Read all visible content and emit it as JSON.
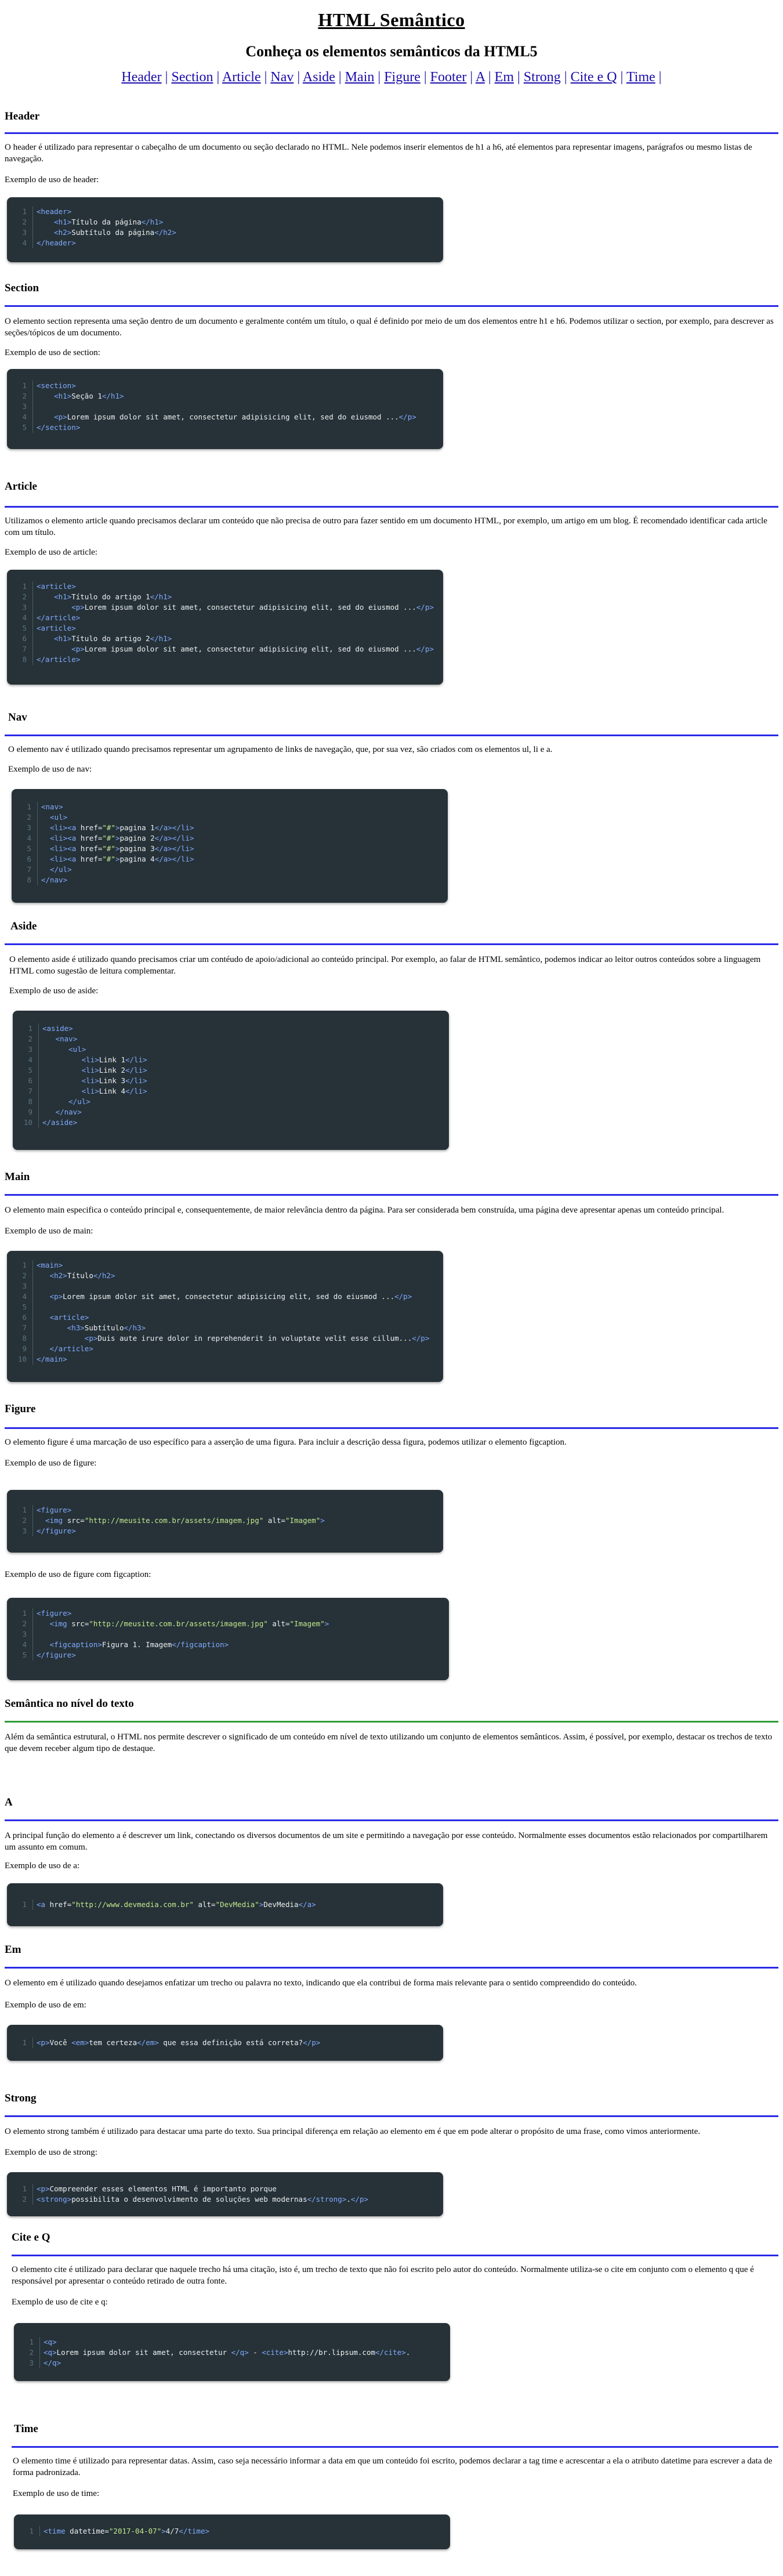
{
  "header": {
    "title": "HTML Semântico",
    "subtitle": "Conheça os elementos semânticos da HTML5",
    "nav": [
      "Header",
      "Section",
      "Article",
      "Nav",
      "Aside",
      "Main",
      "Figure",
      "Footer",
      "A",
      "Em",
      "Strong",
      "Cite e Q",
      "Time"
    ]
  },
  "sections": {
    "header": {
      "title": "Header",
      "text": "O header é utilizado para representar o cabeçalho de um documento ou seção declarado no HTML. Nele podemos inserir elementos de h1 a h6, até elementos para representar imagens, parágrafos ou mesmo listas de navegação.",
      "example_label": "Exemplo de uso de header:",
      "code": [
        "<header>",
        "    <h1>Título da página</h1>",
        "    <h2>Subtítulo da página</h2>",
        "</header>"
      ]
    },
    "section": {
      "title": "Section",
      "text": "O elemento section representa uma seção dentro de um documento e geralmente contém um título, o qual é definido por meio de um dos elementos entre h1 e h6. Podemos utilizar o section, por exemplo, para descrever as seções/tópicos de um documento.",
      "example_label": "Exemplo de uso de section:",
      "code": [
        "<section>",
        "    <h1>Seção 1</h1>",
        "",
        "    <p>Lorem ipsum dolor sit amet, consectetur adipisicing elit, sed do eiusmod ...</p>",
        "</section>"
      ]
    },
    "article": {
      "title": "Article",
      "text": "Utilizamos o elemento article quando precisamos declarar um conteúdo que não precisa de outro para fazer sentido em um documento HTML, por exemplo, um artigo em um blog. É recomendado identificar cada article com um título.",
      "example_label": "Exemplo de uso de article:",
      "code": [
        "<article>",
        "    <h1>Título do artigo 1</h1>",
        "        <p>Lorem ipsum dolor sit amet, consectetur adipisicing elit, sed do eiusmod ...</p>",
        "</article>",
        "<article>",
        "    <h1>Título do artigo 2</h1>",
        "        <p>Lorem ipsum dolor sit amet, consectetur adipisicing elit, sed do eiusmod ...</p>",
        "</article>"
      ]
    },
    "nav": {
      "title": "Nav",
      "text": "O elemento nav é utilizado quando precisamos representar um agrupamento de links de navegação, que, por sua vez, são criados com os elementos ul, li e a.",
      "example_label": "Exemplo de uso de nav:",
      "code": [
        "<nav>",
        "  <ul>",
        "  <li><a href=\"#\">pagina 1</a></li>",
        "  <li><a href=\"#\">pagina 2</a></li>",
        "  <li><a href=\"#\">pagina 3</a></li>",
        "  <li><a href=\"#\">pagina 4</a></li>",
        "  </ul>",
        "</nav>"
      ]
    },
    "aside": {
      "title": "Aside",
      "text": "O elemento aside é utilizado quando precisamos criar um contéudo de apoio/adicional ao conteúdo principal. Por exemplo, ao falar de HTML semântico, podemos indicar ao leitor outros conteúdos sobre a linguagem HTML como sugestão de leitura complementar.",
      "example_label": "Exemplo de uso de aside:",
      "code": [
        "<aside>",
        "   <nav>",
        "      <ul>",
        "         <li>Link 1</li>",
        "         <li>Link 2</li>",
        "         <li>Link 3</li>",
        "         <li>Link 4</li>",
        "      </ul>",
        "   </nav>",
        "</aside>"
      ]
    },
    "main": {
      "title": "Main",
      "text": "O elemento main especifica o conteúdo principal e, consequentemente, de maior relevância dentro da página. Para ser considerada bem construída, uma página deve apresentar apenas um conteúdo principal.",
      "example_label": "Exemplo de uso de main:",
      "code": [
        "<main>",
        "   <h2>Título</h2>",
        "",
        "   <p>Lorem ipsum dolor sit amet, consectetur adipisicing elit, sed do eiusmod ...</p>",
        "",
        "   <article>",
        "       <h3>Subtítulo</h3>",
        "           <p>Duis aute irure dolor in reprehenderit in voluptate velit esse cillum...</p>",
        "   </article>",
        "</main>"
      ]
    },
    "figure": {
      "title": "Figure",
      "text": "O elemento figure é uma marcação de uso específico para a asserção de uma figura. Para incluir a descrição dessa figura, podemos utilizar o elemento figcaption.",
      "example_label": "Exemplo de uso de figure:",
      "code": [
        "<figure>",
        "  <img src=\"http://meusite.com.br/assets/imagem.jpg\" alt=\"Imagem\">",
        "</figure>"
      ],
      "example_label_2": "Exemplo de uso de figure com figcaption:",
      "code_2": [
        "<figure>",
        "   <img src=\"http://meusite.com.br/assets/imagem.jpg\" alt=\"Imagem\">",
        "",
        "   <figcaption>Figura 1. Imagem</figcaption>",
        "</figure>"
      ]
    },
    "semantica": {
      "title": "Semântica no nível do texto",
      "text": "Além da semântica estrutural, o HTML nos permite descrever o significado de um conteúdo em nível de texto utilizando um conjunto de elementos semânticos. Assim, é possível, por exemplo, destacar os trechos de texto que devem receber algum tipo de destaque."
    },
    "a": {
      "title": "A",
      "text": "A principal função do elemento a é descrever um link, conectando os diversos documentos de um site e permitindo a navegação por esse conteúdo. Normalmente esses documentos estão relacionados por compartilharem um assunto em comum.",
      "example_label": "Exemplo de uso de a:",
      "code": [
        "<a href=\"http://www.devmedia.com.br\" alt=\"DevMedia\">DevMedia</a>"
      ]
    },
    "em": {
      "title": "Em",
      "text": "O elemento em é utilizado quando desejamos enfatizar um trecho ou palavra no texto, indicando que ela contribui de forma mais relevante para o sentido compreendido do conteúdo.",
      "example_label": "Exemplo de uso de em:",
      "code": [
        "<p>Você <em>tem certeza</em> que essa definição está correta?</p>"
      ]
    },
    "strong": {
      "title": "Strong",
      "text": "O elemento strong também é utilizado para destacar uma parte do texto. Sua principal diferença em relação ao elemento em é que em pode alterar o propósito de uma frase, como vimos anteriormente.",
      "example_label": "Exemplo de uso de strong:",
      "code": [
        "<p>Compreender esses elementos HTML é importanto porque",
        "<strong>possibilita o desenvolvimento de soluções web modernas</strong>.</p>"
      ]
    },
    "cite": {
      "title": "Cite e Q",
      "text": "O elemento cite é utilizado para declarar que naquele trecho há uma citação, isto é, um trecho de texto que não foi escrito pelo autor do conteúdo. Normalmente utiliza-se o cite em conjunto com o elemento q que é responsável por apresentar o conteúdo retirado de outra fonte.",
      "example_label": "Exemplo de uso de cite e q:",
      "code": [
        "<q>",
        "<q>Lorem ipsum dolor sit amet, consectetur </q> - <cite>http://br.lipsum.com</cite>.",
        "</q>"
      ]
    },
    "time": {
      "title": "Time",
      "text": "O elemento time é utilizado para representar datas. Assim, caso seja necessário informar a data em que um conteúdo foi escrito, podemos declarar a tag time e acrescentar a ela o atributo datetime para escrever a data de forma padronizada.",
      "example_label": "Exemplo de uso de time:",
      "code": [
        "<time datetime=\"2017-04-07\">4/7</time>"
      ]
    }
  },
  "colors": {
    "rule": "#2a2ae6",
    "rule_green": "#2e9c36",
    "code_bg": "#263238",
    "code_tag": "#82aaff",
    "code_string": "#c3e88d",
    "link": "#1a0dab"
  }
}
